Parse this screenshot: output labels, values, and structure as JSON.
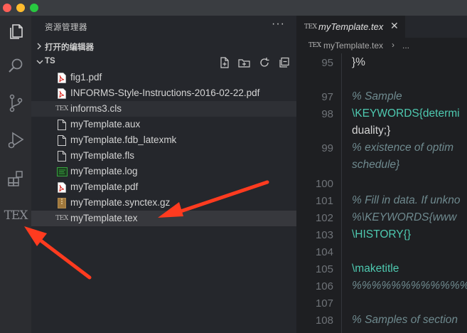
{
  "sidebar": {
    "title": "资源管理器",
    "more_label": "···",
    "open_editors_label": "打开的编辑器",
    "folder_label": "TS",
    "files": [
      {
        "name": "fig1.pdf",
        "icon": "pdf-file-icon"
      },
      {
        "name": "INFORMS-Style-Instructions-2016-02-22.pdf",
        "icon": "pdf-file-icon"
      },
      {
        "name": "informs3.cls",
        "icon": "tex-file-icon"
      },
      {
        "name": "myTemplate.aux",
        "icon": "file-icon"
      },
      {
        "name": "myTemplate.fdb_latexmk",
        "icon": "file-icon"
      },
      {
        "name": "myTemplate.fls",
        "icon": "file-icon"
      },
      {
        "name": "myTemplate.log",
        "icon": "log-file-icon"
      },
      {
        "name": "myTemplate.pdf",
        "icon": "pdf-file-icon"
      },
      {
        "name": "myTemplate.synctex.gz",
        "icon": "archive-file-icon"
      },
      {
        "name": "myTemplate.tex",
        "icon": "tex-file-icon"
      }
    ]
  },
  "activity": {
    "tex_label": "TEX"
  },
  "editor": {
    "tab_label": "myTemplate.tex",
    "tab_close": "✕",
    "breadcrumb_file": "myTemplate.tex",
    "breadcrumb_sep": "›",
    "breadcrumb_more": "...",
    "tex_glyph": "TEX",
    "lines": [
      {
        "num": "95",
        "text": "}%"
      },
      {
        "num": "",
        "text": ""
      },
      {
        "num": "97",
        "text": "% Sample"
      },
      {
        "num": "98",
        "text": "\\KEYWORDS{determi"
      },
      {
        "num": "",
        "text": "duality;}"
      },
      {
        "num": "99",
        "text": "%  existence of optim"
      },
      {
        "num": "",
        "text": "schedule}"
      },
      {
        "num": "100",
        "text": ""
      },
      {
        "num": "101",
        "text": "% Fill in data. If unkno"
      },
      {
        "num": "102",
        "text": "%\\KEYWORDS{www"
      },
      {
        "num": "103",
        "text": "\\HISTORY{}"
      },
      {
        "num": "104",
        "text": ""
      },
      {
        "num": "105",
        "text": "\\maketitle"
      },
      {
        "num": "106",
        "text": "%%%%%%%%%%%%"
      },
      {
        "num": "107",
        "text": ""
      },
      {
        "num": "108",
        "text": "% Samples of section"
      }
    ]
  },
  "colors": {
    "arrow": "#ff3b1f",
    "accent_cmd": "#4ec9b0"
  }
}
